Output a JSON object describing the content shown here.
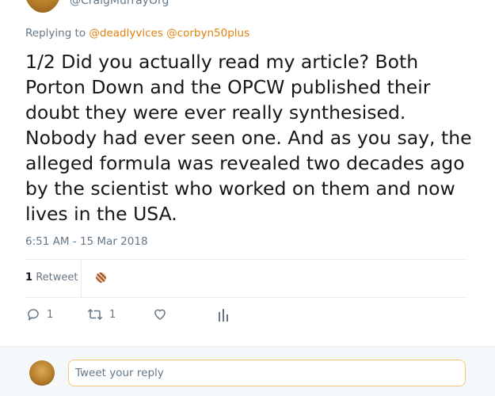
{
  "author": {
    "handle": "@CraigMurrayOrg"
  },
  "replying": {
    "prefix": "Replying to",
    "mentions": [
      "@deadlyvices",
      "@corbyn50plus"
    ]
  },
  "tweet": {
    "text": "1/2 Did you actually read my article? Both Porton Down and the OPCW published their doubt they were ever really synthesised. Nobody had ever seen one. And as you say, the alleged formula was revealed two decades ago by the scientist who worked on them and now lives in the USA.",
    "timestamp": "6:51 AM - 15 Mar 2018"
  },
  "stats": {
    "retweets_count": "1",
    "retweets_label": "Retweet"
  },
  "actions": {
    "reply_count": "1",
    "retweet_count": "1"
  },
  "reply_box": {
    "placeholder": "Tweet your reply"
  },
  "colors": {
    "mention": "#e0820d",
    "muted": "#657786",
    "input_border": "#f3c77a"
  },
  "icons": {
    "reply": "reply-icon",
    "retweet": "retweet-icon",
    "like": "heart-icon",
    "analytics": "analytics-icon"
  }
}
